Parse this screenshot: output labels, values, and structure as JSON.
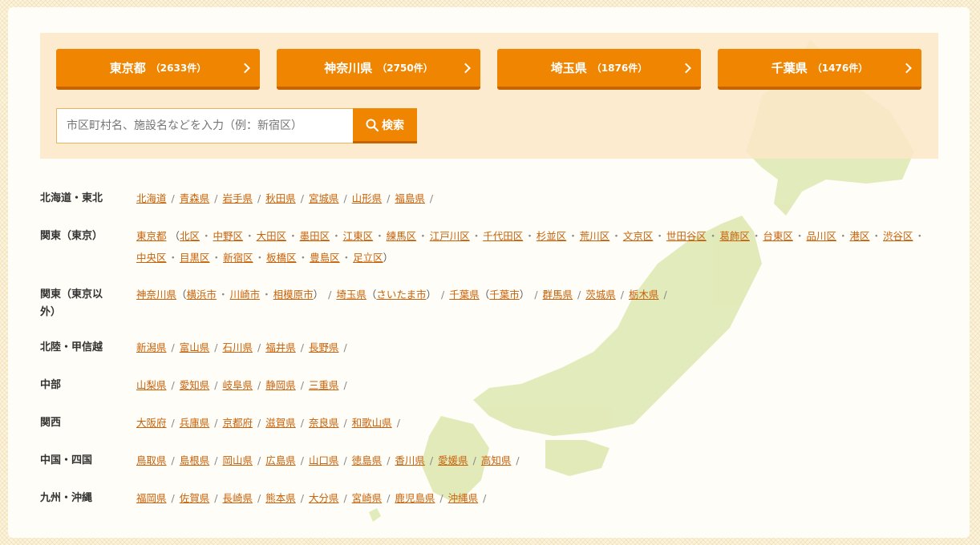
{
  "top_buttons": [
    {
      "name": "東京都",
      "count": "（2633件）"
    },
    {
      "name": "神奈川県",
      "count": "（2750件）"
    },
    {
      "name": "埼玉県",
      "count": "（1876件）"
    },
    {
      "name": "千葉県",
      "count": "（1476件）"
    }
  ],
  "search": {
    "placeholder": "市区町村名、施設名などを入力（例：新宿区）",
    "button_label": "検索"
  },
  "regions": [
    {
      "name": "北海道・東北",
      "items": [
        {
          "t": "link",
          "v": "北海道"
        },
        {
          "t": "sep",
          "v": "/"
        },
        {
          "t": "link",
          "v": "青森県"
        },
        {
          "t": "sep",
          "v": "/"
        },
        {
          "t": "link",
          "v": "岩手県"
        },
        {
          "t": "sep",
          "v": "/"
        },
        {
          "t": "link",
          "v": "秋田県"
        },
        {
          "t": "sep",
          "v": "/"
        },
        {
          "t": "link",
          "v": "宮城県"
        },
        {
          "t": "sep",
          "v": "/"
        },
        {
          "t": "link",
          "v": "山形県"
        },
        {
          "t": "sep",
          "v": "/"
        },
        {
          "t": "link",
          "v": "福島県"
        },
        {
          "t": "sep",
          "v": "/"
        }
      ]
    },
    {
      "name": "関東（東京）",
      "items": [
        {
          "t": "link",
          "v": "東京都"
        },
        {
          "t": "text",
          "v": " （"
        },
        {
          "t": "link",
          "v": "北区"
        },
        {
          "t": "dot",
          "v": "・"
        },
        {
          "t": "link",
          "v": "中野区"
        },
        {
          "t": "dot",
          "v": "・"
        },
        {
          "t": "link",
          "v": "大田区"
        },
        {
          "t": "dot",
          "v": "・"
        },
        {
          "t": "link",
          "v": "墨田区"
        },
        {
          "t": "dot",
          "v": "・"
        },
        {
          "t": "link",
          "v": "江東区"
        },
        {
          "t": "dot",
          "v": "・"
        },
        {
          "t": "link",
          "v": "練馬区"
        },
        {
          "t": "dot",
          "v": "・"
        },
        {
          "t": "link",
          "v": "江戸川区"
        },
        {
          "t": "dot",
          "v": "・"
        },
        {
          "t": "link",
          "v": "千代田区"
        },
        {
          "t": "dot",
          "v": "・"
        },
        {
          "t": "link",
          "v": "杉並区"
        },
        {
          "t": "dot",
          "v": "・"
        },
        {
          "t": "link",
          "v": "荒川区"
        },
        {
          "t": "dot",
          "v": "・"
        },
        {
          "t": "link",
          "v": "文京区"
        },
        {
          "t": "dot",
          "v": "・"
        },
        {
          "t": "link",
          "v": "世田谷区"
        },
        {
          "t": "dot",
          "v": "・"
        },
        {
          "t": "link",
          "v": "葛飾区"
        },
        {
          "t": "dot",
          "v": "・"
        },
        {
          "t": "link",
          "v": "台東区"
        },
        {
          "t": "dot",
          "v": "・"
        },
        {
          "t": "link",
          "v": "品川区"
        },
        {
          "t": "dot",
          "v": "・"
        },
        {
          "t": "link",
          "v": "港区"
        },
        {
          "t": "dot",
          "v": "・"
        },
        {
          "t": "link",
          "v": "渋谷区"
        },
        {
          "t": "dot",
          "v": "・"
        },
        {
          "t": "link",
          "v": "中央区"
        },
        {
          "t": "dot",
          "v": "・"
        },
        {
          "t": "link",
          "v": "目黒区"
        },
        {
          "t": "dot",
          "v": "・"
        },
        {
          "t": "link",
          "v": "新宿区"
        },
        {
          "t": "dot",
          "v": "・"
        },
        {
          "t": "link",
          "v": "板橋区"
        },
        {
          "t": "dot",
          "v": "・"
        },
        {
          "t": "link",
          "v": "豊島区"
        },
        {
          "t": "dot",
          "v": "・"
        },
        {
          "t": "link",
          "v": "足立区"
        },
        {
          "t": "text",
          "v": "）"
        }
      ]
    },
    {
      "name": "関東（東京以外）",
      "items": [
        {
          "t": "link",
          "v": "神奈川県"
        },
        {
          "t": "text",
          "v": "（"
        },
        {
          "t": "link",
          "v": "横浜市"
        },
        {
          "t": "dot",
          "v": "・"
        },
        {
          "t": "link",
          "v": "川崎市"
        },
        {
          "t": "dot",
          "v": "・"
        },
        {
          "t": "link",
          "v": "相模原市"
        },
        {
          "t": "text",
          "v": "）"
        },
        {
          "t": "sep",
          "v": "/"
        },
        {
          "t": "link",
          "v": "埼玉県"
        },
        {
          "t": "text",
          "v": "（"
        },
        {
          "t": "link",
          "v": "さいたま市"
        },
        {
          "t": "text",
          "v": "）"
        },
        {
          "t": "sep",
          "v": "/"
        },
        {
          "t": "link",
          "v": "千葉県"
        },
        {
          "t": "text",
          "v": "（"
        },
        {
          "t": "link",
          "v": "千葉市"
        },
        {
          "t": "text",
          "v": "）"
        },
        {
          "t": "sep",
          "v": "/"
        },
        {
          "t": "link",
          "v": "群馬県"
        },
        {
          "t": "sep",
          "v": "/"
        },
        {
          "t": "link",
          "v": "茨城県"
        },
        {
          "t": "sep",
          "v": "/"
        },
        {
          "t": "link",
          "v": "栃木県"
        },
        {
          "t": "sep",
          "v": "/"
        }
      ]
    },
    {
      "name": "北陸・甲信越",
      "items": [
        {
          "t": "link",
          "v": "新潟県"
        },
        {
          "t": "sep",
          "v": "/"
        },
        {
          "t": "link",
          "v": "富山県"
        },
        {
          "t": "sep",
          "v": "/"
        },
        {
          "t": "link",
          "v": "石川県"
        },
        {
          "t": "sep",
          "v": "/"
        },
        {
          "t": "link",
          "v": "福井県"
        },
        {
          "t": "sep",
          "v": "/"
        },
        {
          "t": "link",
          "v": "長野県"
        },
        {
          "t": "sep",
          "v": "/"
        }
      ]
    },
    {
      "name": "中部",
      "items": [
        {
          "t": "link",
          "v": "山梨県"
        },
        {
          "t": "sep",
          "v": "/"
        },
        {
          "t": "link",
          "v": "愛知県"
        },
        {
          "t": "sep",
          "v": "/"
        },
        {
          "t": "link",
          "v": "岐阜県"
        },
        {
          "t": "sep",
          "v": "/"
        },
        {
          "t": "link",
          "v": "静岡県"
        },
        {
          "t": "sep",
          "v": "/"
        },
        {
          "t": "link",
          "v": "三重県"
        },
        {
          "t": "sep",
          "v": "/"
        }
      ]
    },
    {
      "name": "関西",
      "items": [
        {
          "t": "link",
          "v": "大阪府"
        },
        {
          "t": "sep",
          "v": "/"
        },
        {
          "t": "link",
          "v": "兵庫県"
        },
        {
          "t": "sep",
          "v": "/"
        },
        {
          "t": "link",
          "v": "京都府"
        },
        {
          "t": "sep",
          "v": "/"
        },
        {
          "t": "link",
          "v": "滋賀県"
        },
        {
          "t": "sep",
          "v": "/"
        },
        {
          "t": "link",
          "v": "奈良県"
        },
        {
          "t": "sep",
          "v": "/"
        },
        {
          "t": "link",
          "v": "和歌山県"
        },
        {
          "t": "sep",
          "v": "/"
        }
      ]
    },
    {
      "name": "中国・四国",
      "items": [
        {
          "t": "link",
          "v": "鳥取県"
        },
        {
          "t": "sep",
          "v": "/"
        },
        {
          "t": "link",
          "v": "島根県"
        },
        {
          "t": "sep",
          "v": "/"
        },
        {
          "t": "link",
          "v": "岡山県"
        },
        {
          "t": "sep",
          "v": "/"
        },
        {
          "t": "link",
          "v": "広島県"
        },
        {
          "t": "sep",
          "v": "/"
        },
        {
          "t": "link",
          "v": "山口県"
        },
        {
          "t": "sep",
          "v": "/"
        },
        {
          "t": "link",
          "v": "徳島県"
        },
        {
          "t": "sep",
          "v": "/"
        },
        {
          "t": "link",
          "v": "香川県"
        },
        {
          "t": "sep",
          "v": "/"
        },
        {
          "t": "link",
          "v": "愛媛県"
        },
        {
          "t": "sep",
          "v": "/"
        },
        {
          "t": "link",
          "v": "高知県"
        },
        {
          "t": "sep",
          "v": "/"
        }
      ]
    },
    {
      "name": "九州・沖縄",
      "items": [
        {
          "t": "link",
          "v": "福岡県"
        },
        {
          "t": "sep",
          "v": "/"
        },
        {
          "t": "link",
          "v": "佐賀県"
        },
        {
          "t": "sep",
          "v": "/"
        },
        {
          "t": "link",
          "v": "長崎県"
        },
        {
          "t": "sep",
          "v": "/"
        },
        {
          "t": "link",
          "v": "熊本県"
        },
        {
          "t": "sep",
          "v": "/"
        },
        {
          "t": "link",
          "v": "大分県"
        },
        {
          "t": "sep",
          "v": "/"
        },
        {
          "t": "link",
          "v": "宮崎県"
        },
        {
          "t": "sep",
          "v": "/"
        },
        {
          "t": "link",
          "v": "鹿児島県"
        },
        {
          "t": "sep",
          "v": "/"
        },
        {
          "t": "link",
          "v": "沖縄県"
        },
        {
          "t": "sep",
          "v": "/"
        }
      ]
    }
  ],
  "colors": {
    "accent": "#ef8500",
    "link": "#c8620a",
    "panel": "#fde8c8",
    "map": "#dfe9b4"
  },
  "icons": {
    "search": "search-icon",
    "chevron": "chevron-right-icon",
    "map": "japan-map-icon"
  }
}
